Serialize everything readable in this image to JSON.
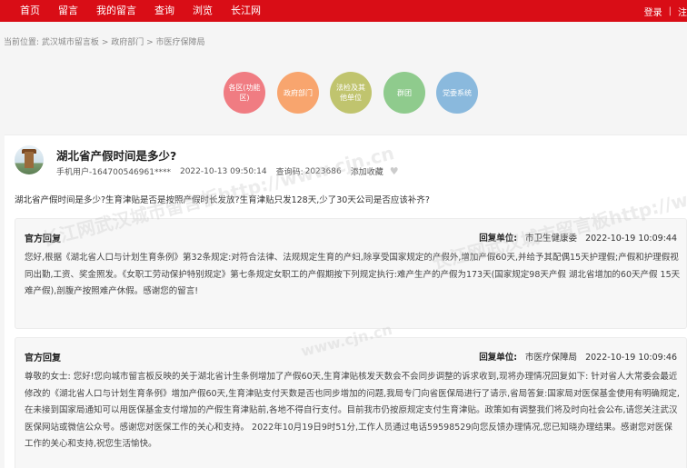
{
  "nav": {
    "items": [
      "首页",
      "留言",
      "我的留言",
      "查询",
      "浏览",
      "长江网"
    ],
    "login": "登录",
    "register": "注"
  },
  "breadcrumb": {
    "prefix": "当前位置:",
    "items": [
      "武汉城市留言板",
      "政府部门",
      "市医疗保障局"
    ],
    "separator": ">"
  },
  "categories": [
    {
      "label": "各区(功能区)",
      "color": "#f07c82"
    },
    {
      "label": "政府部门",
      "color": "#f8a56e"
    },
    {
      "label": "法检及其他单位",
      "color": "#c0c46e"
    },
    {
      "label": "群团",
      "color": "#8fcb8d"
    },
    {
      "label": "党委系统",
      "color": "#8ab9dd"
    }
  ],
  "message": {
    "title": "湖北省产假时间是多少?",
    "user": "手机用户-164700546961****",
    "time": "2022-10-13 09:50:14",
    "code_label": "查询码:",
    "code": "2023686",
    "favorite": "添加收藏",
    "content": "湖北省产假时间是多少?生育津贴是否是按照产假时长发放?生育津贴只发128天,少了30天公司是否应该补齐?"
  },
  "replies": [
    {
      "label": "官方回复",
      "unit_label": "回复单位:",
      "unit": "市卫生健康委",
      "time": "2022-10-19 10:09:44",
      "content": "您好,根据《湖北省人口与计划生育条例》第32条规定:对符合法律、法规规定生育的产妇,除享受国家规定的产假外,增加产假60天,并给予其配偶15天护理假;产假和护理假视同出勤,工资、奖金照发。《女职工劳动保护特别规定》第七条规定女职工的产假期按下列规定执行:难产生产的产假为173天(国家规定98天产假 湖北省增加的60天产假 15天难产假),剖腹产按照难产休假。感谢您的留言!"
    },
    {
      "label": "官方回复",
      "unit_label": "回复单位:",
      "unit": "市医疗保障局",
      "time": "2022-10-19 10:09:46",
      "content": "尊敬的女士: 您好!您向城市留言板反映的关于湖北省计生条例增加了产假60天,生育津贴核发天数会不会同步调整的诉求收到,现将办理情况回复如下: 针对省人大常委会最近修改的《湖北省人口与计划生育条例》增加产假60天,生育津贴支付天数是否也同步增加的问题,我局专门向省医保局进行了请示,省局答复:国家局对医保基金使用有明确规定,在未接到国家局通知可以用医保基金支付增加的产假生育津贴前,各地不得自行支付。目前我市仍按原规定支付生育津贴。政策如有调整我们将及时向社会公布,请您关注武汉医保网站或微信公众号。感谢您对医保工作的关心和支持。 2022年10月19日9时51分,工作人员通过电话59598529向您反馈办理情况,您已知晓办理结果。感谢您对医保工作的关心和支持,祝您生活愉快。"
    }
  ],
  "watermark": {
    "text1": "长江网武汉城市留言板http://www.cjn.cn",
    "text2": "www.cjn.cn"
  }
}
